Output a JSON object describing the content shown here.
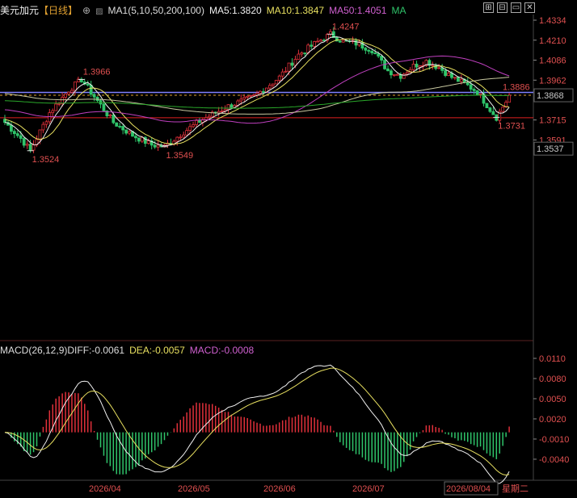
{
  "header": {
    "symbol": "美元加元",
    "period": "【日线】",
    "ma_label": "MA1(5,10,50,200,100)",
    "ma5": "MA5:1.3820",
    "ma10": "MA10:1.3847",
    "ma50": "MA50:1.4051",
    "ma_extra": "MA"
  },
  "macd_header": {
    "title": "MACD(26,12,9)",
    "diff": "DIFF:-0.0061",
    "dea": "DEA:-0.0057",
    "macd": "MACD:-0.0008"
  },
  "colors": {
    "up": "#e0303a",
    "down": "#2fc46a",
    "ma5": "#f0f0f0",
    "ma10": "#e8e060",
    "ma50": "#c040c0",
    "ma200": "#2aa82a",
    "ma100": "#c8c8a0",
    "blue_line": "#8080ff",
    "red_line": "#e02020",
    "dashed": "#e0a030"
  },
  "icons": [
    "grid-icon",
    "chart-icon",
    "collapse-icon",
    "close-icon"
  ],
  "chart_data": [
    {
      "type": "candlestick",
      "title": "美元加元",
      "y_ticks": [
        "1.4334",
        "1.4210",
        "1.4086",
        "1.3962",
        "1.3715",
        "1.3591"
      ],
      "ylim": [
        1.347,
        1.434
      ],
      "current_price": "1.3868",
      "low_marker": "1.3537",
      "horizontal_line_blue": "1.3886",
      "horizontal_line_red": 1.3729,
      "annotations": [
        {
          "label": "1.3524",
          "type": "low"
        },
        {
          "label": "1.3966",
          "type": "high"
        },
        {
          "label": "1.3549",
          "type": "low"
        },
        {
          "label": "1.4247",
          "type": "high"
        },
        {
          "label": "1.3731",
          "type": "low"
        }
      ],
      "x_labels": [
        "2026/04",
        "2026/05",
        "2026/06",
        "2026/07",
        "2026/08/04",
        "星期二"
      ],
      "series": [
        {
          "name": "MA5",
          "value": 1.382
        },
        {
          "name": "MA10",
          "value": 1.3847
        },
        {
          "name": "MA50",
          "value": 1.4051
        }
      ]
    },
    {
      "type": "macd",
      "title": "MACD(26,12,9)",
      "y_ticks": [
        "0.0110",
        "0.0080",
        "0.0050",
        "0.0020",
        "-0.0010",
        "-0.0040"
      ],
      "ylim": [
        -0.006,
        0.0125
      ],
      "diff": -0.0061,
      "dea": -0.0057,
      "macd": -0.0008
    }
  ]
}
